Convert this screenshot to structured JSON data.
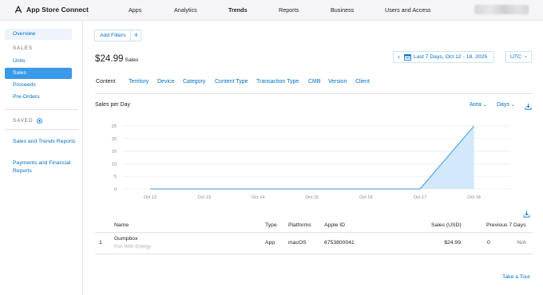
{
  "brand": {
    "name": "App Store Connect",
    "icon": "app-store-connect-icon"
  },
  "nav": [
    "Apps",
    "Analytics",
    "Trends",
    "Reports",
    "Business",
    "Users and Access"
  ],
  "nav_active": "Trends",
  "sidebar": {
    "overview": "Overview",
    "sales_header": "SALES",
    "items": [
      "Units",
      "Sales",
      "Proceeds",
      "Pre-Orders"
    ],
    "selected": "Sales",
    "saved_header": "SAVED",
    "saved_links": [
      "Sales and Trends Reports",
      "Payments and Financial Reports"
    ]
  },
  "filters": {
    "add_label": "Add Filters",
    "plus": "+"
  },
  "summary": {
    "amount": "$24.99",
    "unit": "Sales"
  },
  "date_range": {
    "label": "Last 7 Days, Oct 12 - 18, 2025",
    "prev": "‹"
  },
  "timezone": {
    "value": "UTC",
    "caret": "⌄"
  },
  "tabs": [
    "Content",
    "Territory",
    "Device",
    "Category",
    "Content Type",
    "Transaction Type",
    "CMB",
    "Version",
    "Client"
  ],
  "active_tab": "Content",
  "chart_section": {
    "title": "Sales per Day",
    "chart_type_control": "Area",
    "interval_control": "Days",
    "caret": "⌄"
  },
  "chart_data": {
    "type": "area",
    "categories": [
      "Oct 12",
      "Oct 13",
      "Oct 14",
      "Oct 15",
      "Oct 16",
      "Oct 17",
      "Oct 18"
    ],
    "values": [
      0,
      0,
      0,
      0,
      0,
      0,
      24.99
    ],
    "yticks": [
      "0",
      "5",
      "10",
      "15",
      "20",
      "25"
    ],
    "ylim": [
      0,
      25
    ],
    "grid": true,
    "color": "#3a99e8",
    "fill": "#d3e8fa"
  },
  "table": {
    "headers": {
      "name": "Name",
      "type": "Type",
      "platforms": "Platforms",
      "apple_id": "Apple ID",
      "sales": "Sales (USD)",
      "previous": "Previous 7 Days"
    },
    "rows": [
      {
        "rank": "1",
        "name": "Gumpbox",
        "sub": "Fun With Energy",
        "type": "App",
        "platforms": "macOS",
        "apple_id": "6753800041",
        "sales": "$24.99",
        "previous": "0",
        "change": "N/A"
      }
    ]
  },
  "footer": {
    "tour": "Take a Tour"
  }
}
